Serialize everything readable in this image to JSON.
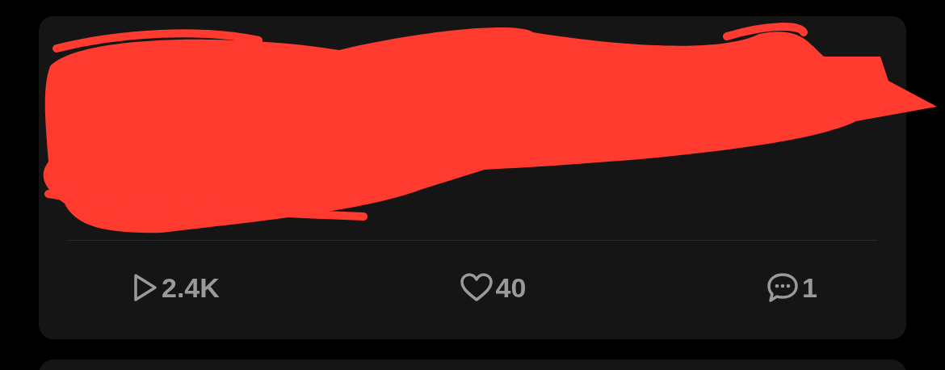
{
  "stats": [
    {
      "kind": "plays",
      "value": "2.4K"
    },
    {
      "kind": "likes",
      "value": "40"
    },
    {
      "kind": "comments",
      "value": "1"
    }
  ]
}
